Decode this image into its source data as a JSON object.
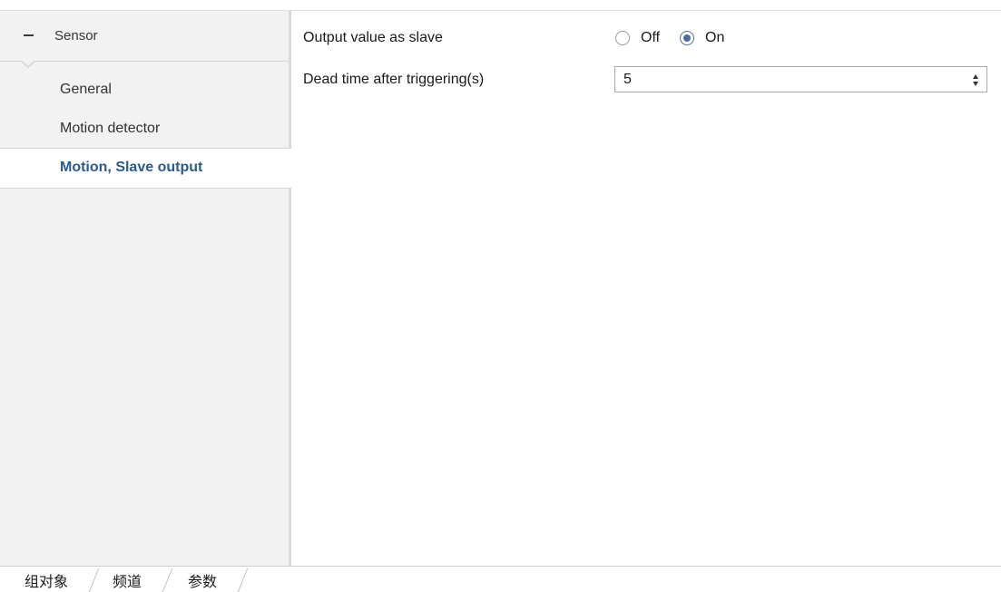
{
  "sidebar": {
    "group": {
      "label": "Sensor",
      "toggle_icon": "minus-icon"
    },
    "items": [
      {
        "label": "General",
        "selected": false
      },
      {
        "label": "Motion detector",
        "selected": false
      },
      {
        "label": "Motion, Slave output",
        "selected": true
      }
    ]
  },
  "params": {
    "output_value_as_slave": {
      "label": "Output value as slave",
      "options": [
        "Off",
        "On"
      ],
      "selected": "On"
    },
    "dead_time": {
      "label": "Dead time after triggering(s)",
      "value": "5"
    }
  },
  "tabs": [
    {
      "label": "组对象"
    },
    {
      "label": "频道"
    },
    {
      "label": "参数",
      "active": true
    }
  ],
  "colors": {
    "accent": "#2a5b90",
    "sidebar_bg": "#f2f2f2",
    "radio_dot": "#4d6a9a"
  }
}
